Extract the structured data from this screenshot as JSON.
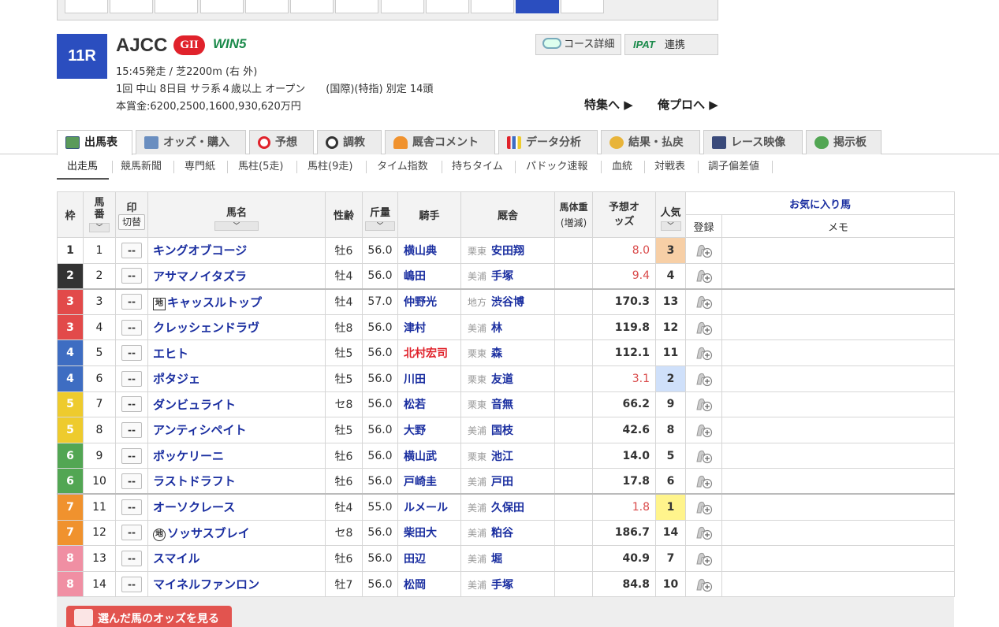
{
  "header": {
    "race_number": "11R",
    "race_name": "AJCC",
    "grade": "GII",
    "win5": "WIN5",
    "info_line1": "15:45発走 / 芝2200m (右 外)",
    "info_line2": "1回 中山 8日目 サラ系４歳以上 オープン　　(国際)(特指) 別定 14頭",
    "info_line3": "本賞金:6200,2500,1600,930,620万円",
    "course_btn": "コース詳細",
    "ipat_logo": "IPAT",
    "ipat_label": "連携",
    "feature_link": "特集へ ▶",
    "pro_link": "俺プロへ ▶"
  },
  "main_tabs": [
    "出馬表",
    "オッズ・購入",
    "予想",
    "調教",
    "厩舎コメント",
    "データ分析",
    "結果・払戻",
    "レース映像",
    "掲示板"
  ],
  "sub_tabs": [
    "出走馬",
    "競馬新聞",
    "専門紙",
    "馬柱(5走)",
    "馬柱(9走)",
    "タイム指数",
    "持ちタイム",
    "パドック速報",
    "血統",
    "対戦表",
    "調子偏差値"
  ],
  "table_headers": {
    "waku": "枠",
    "umaban": "馬番",
    "mark": "印",
    "mark_toggle": "切替",
    "horse": "馬名",
    "sex_age": "性齢",
    "weight": "斤量",
    "jockey": "騎手",
    "trainer": "厩舎",
    "body_weight": "馬体重",
    "body_weight_sub": "(増減)",
    "odds": "予想オッズ",
    "popularity": "人気",
    "favorite": "お気に入り馬",
    "register": "登録",
    "memo": "メモ"
  },
  "mark_placeholder": "--",
  "horses": [
    {
      "waku": "1",
      "umaban": "1",
      "name": "キングオブコージ",
      "chihou": "",
      "sex_age": "牡6",
      "weight": "56.0",
      "jockey": "横山典",
      "region": "栗東",
      "trainer": "安田翔",
      "odds": "8.0",
      "pop": "3"
    },
    {
      "waku": "2",
      "umaban": "2",
      "name": "アサマノイタズラ",
      "chihou": "",
      "sex_age": "牡4",
      "weight": "56.0",
      "jockey": "嶋田",
      "region": "美浦",
      "trainer": "手塚",
      "odds": "9.4",
      "pop": "4"
    },
    {
      "waku": "3",
      "umaban": "3",
      "name": "キャッスルトップ",
      "chihou": "地",
      "sex_age": "牡4",
      "weight": "57.0",
      "jockey": "仲野光",
      "region": "地方",
      "trainer": "渋谷博",
      "odds": "170.3",
      "pop": "13"
    },
    {
      "waku": "3",
      "umaban": "4",
      "name": "クレッシェンドラヴ",
      "chihou": "",
      "sex_age": "牡8",
      "weight": "56.0",
      "jockey": "津村",
      "region": "美浦",
      "trainer": "林",
      "odds": "119.8",
      "pop": "12"
    },
    {
      "waku": "4",
      "umaban": "5",
      "name": "エヒト",
      "chihou": "",
      "sex_age": "牡5",
      "weight": "56.0",
      "jockey": "北村宏司",
      "region": "栗東",
      "trainer": "森",
      "odds": "112.1",
      "pop": "11"
    },
    {
      "waku": "4",
      "umaban": "6",
      "name": "ポタジェ",
      "chihou": "",
      "sex_age": "牡5",
      "weight": "56.0",
      "jockey": "川田",
      "region": "栗東",
      "trainer": "友道",
      "odds": "3.1",
      "pop": "2"
    },
    {
      "waku": "5",
      "umaban": "7",
      "name": "ダンビュライト",
      "chihou": "",
      "sex_age": "セ8",
      "weight": "56.0",
      "jockey": "松若",
      "region": "栗東",
      "trainer": "音無",
      "odds": "66.2",
      "pop": "9"
    },
    {
      "waku": "5",
      "umaban": "8",
      "name": "アンティシペイト",
      "chihou": "",
      "sex_age": "牡5",
      "weight": "56.0",
      "jockey": "大野",
      "region": "美浦",
      "trainer": "国枝",
      "odds": "42.6",
      "pop": "8"
    },
    {
      "waku": "6",
      "umaban": "9",
      "name": "ポッケリーニ",
      "chihou": "",
      "sex_age": "牡6",
      "weight": "56.0",
      "jockey": "横山武",
      "region": "栗東",
      "trainer": "池江",
      "odds": "14.0",
      "pop": "5"
    },
    {
      "waku": "6",
      "umaban": "10",
      "name": "ラストドラフト",
      "chihou": "",
      "sex_age": "牡6",
      "weight": "56.0",
      "jockey": "戸崎圭",
      "region": "美浦",
      "trainer": "戸田",
      "odds": "17.8",
      "pop": "6"
    },
    {
      "waku": "7",
      "umaban": "11",
      "name": "オーソクレース",
      "chihou": "",
      "sex_age": "牡4",
      "weight": "55.0",
      "jockey": "ルメール",
      "region": "美浦",
      "trainer": "久保田",
      "odds": "1.8",
      "pop": "1"
    },
    {
      "waku": "7",
      "umaban": "12",
      "name": "ソッサスブレイ",
      "chihou": "地",
      "sex_age": "セ8",
      "weight": "56.0",
      "jockey": "柴田大",
      "region": "美浦",
      "trainer": "粕谷",
      "odds": "186.7",
      "pop": "14"
    },
    {
      "waku": "8",
      "umaban": "13",
      "name": "スマイル",
      "chihou": "",
      "sex_age": "牡6",
      "weight": "56.0",
      "jockey": "田辺",
      "region": "美浦",
      "trainer": "堀",
      "odds": "40.9",
      "pop": "7"
    },
    {
      "waku": "8",
      "umaban": "14",
      "name": "マイネルファンロン",
      "chihou": "",
      "sex_age": "牡7",
      "weight": "56.0",
      "jockey": "松岡",
      "region": "美浦",
      "trainer": "手塚",
      "odds": "84.8",
      "pop": "10"
    }
  ],
  "bottom": {
    "odds_button": "選んだ馬のオッズを見る"
  },
  "colors": {
    "accent": "#2b4ebf",
    "waku_1": "#ffffff",
    "waku_2": "#333333",
    "waku_3": "#e24a4a",
    "waku_4": "#3e6dc2",
    "waku_5": "#eecb2d",
    "waku_6": "#52a653",
    "waku_7": "#f0922e",
    "waku_8": "#f08fa3"
  }
}
